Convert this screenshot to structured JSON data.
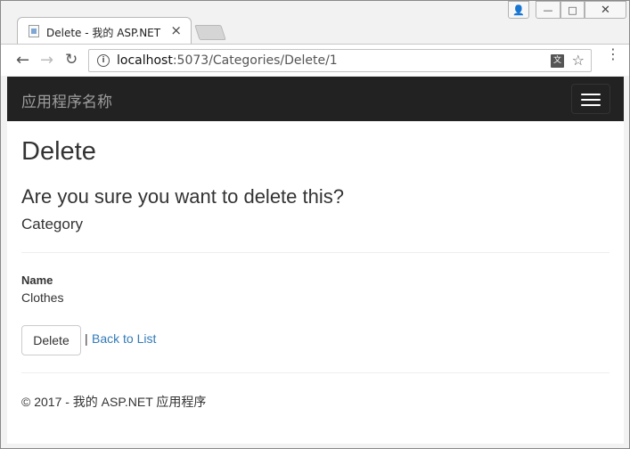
{
  "browser": {
    "tab_title": "Delete - 我的 ASP.NET",
    "tab_close": "×",
    "url_host": "localhost",
    "url_rest": ":5073/Categories/Delete/1",
    "info_glyph": "i",
    "translate_glyph": "文",
    "star_glyph": "☆",
    "back_glyph": "←",
    "forward_glyph": "→",
    "reload_glyph": "↻",
    "menu_glyph": "⋮",
    "close_glyph": "✕",
    "min_glyph": "—",
    "max_glyph": "□",
    "user_glyph": "👤"
  },
  "navbar": {
    "brand": "应用程序名称"
  },
  "main": {
    "title": "Delete",
    "question": "Are you sure you want to delete this?",
    "entity": "Category",
    "field_label": "Name",
    "field_value": "Clothes",
    "delete_button": "Delete",
    "separator": "|",
    "back_link": "Back to List"
  },
  "footer": {
    "text": "© 2017 - 我的 ASP.NET 应用程序"
  }
}
